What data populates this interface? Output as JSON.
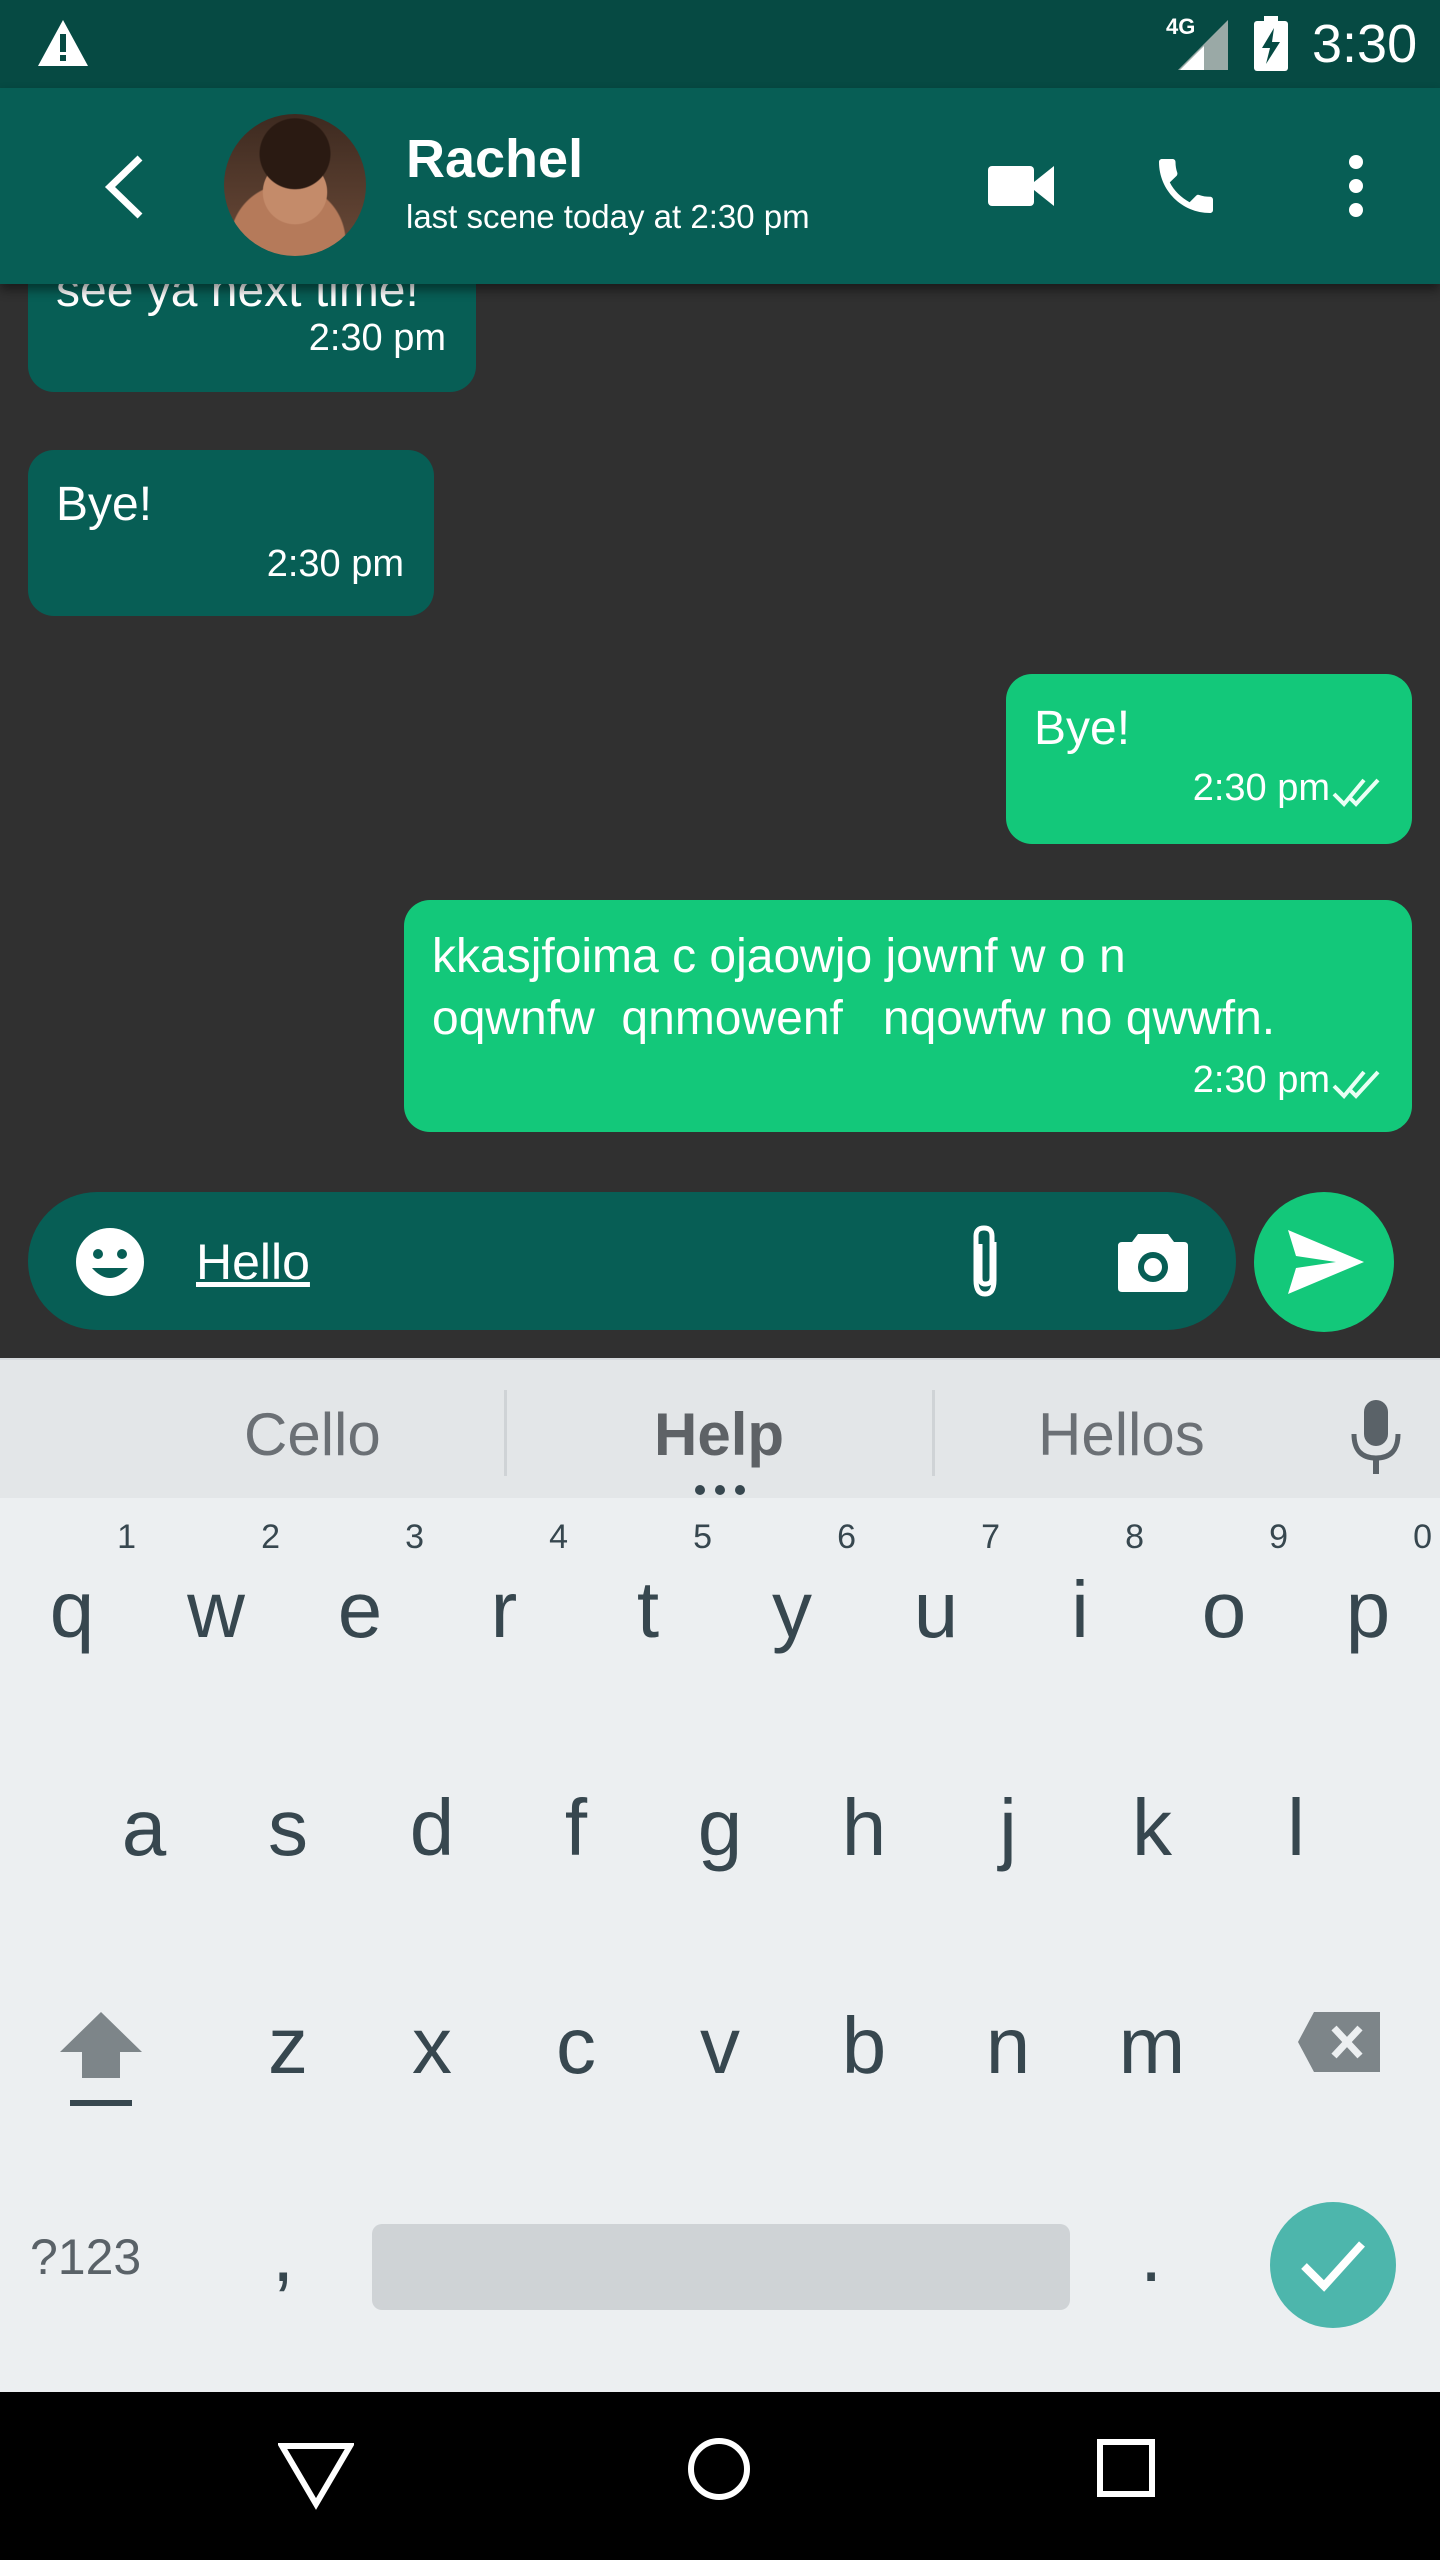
{
  "status_bar": {
    "time": "3:30",
    "network_label": "4G"
  },
  "header": {
    "contact_name": "Rachel",
    "contact_status": "last scene today at 2:30 pm"
  },
  "messages": [
    {
      "direction": "in",
      "text": "see ya next time!",
      "time": "2:30 pm"
    },
    {
      "direction": "in",
      "text": "Bye!",
      "time": "2:30 pm"
    },
    {
      "direction": "out",
      "text": "Bye!",
      "time": "2:30 pm"
    },
    {
      "direction": "out",
      "text": "kkasjfoima c ojaowjo jownf w o n\noqwnfw  qnmowenf   nqowfw no qwwfn.",
      "time": "2:30 pm"
    }
  ],
  "composer": {
    "value": "Hello"
  },
  "keyboard": {
    "suggestions": [
      "Cello",
      "Help",
      "Hellos"
    ],
    "row1": [
      {
        "ch": "q",
        "num": "1"
      },
      {
        "ch": "w",
        "num": "2"
      },
      {
        "ch": "e",
        "num": "3"
      },
      {
        "ch": "r",
        "num": "4"
      },
      {
        "ch": "t",
        "num": "5"
      },
      {
        "ch": "y",
        "num": "6"
      },
      {
        "ch": "u",
        "num": "7"
      },
      {
        "ch": "i",
        "num": "8"
      },
      {
        "ch": "o",
        "num": "9"
      },
      {
        "ch": "p",
        "num": "0"
      }
    ],
    "row2": [
      "a",
      "s",
      "d",
      "f",
      "g",
      "h",
      "j",
      "k",
      "l"
    ],
    "row3": [
      "z",
      "x",
      "c",
      "v",
      "b",
      "n",
      "m"
    ],
    "symbols_label": "?123",
    "comma_label": ",",
    "period_label": "."
  },
  "colors": {
    "status_bar": "#064a43",
    "app_bar": "#075e55",
    "incoming_bubble": "#075e55",
    "outgoing_bubble": "#13c87a",
    "chat_background": "#303030",
    "enter_key": "#4db6ac"
  }
}
